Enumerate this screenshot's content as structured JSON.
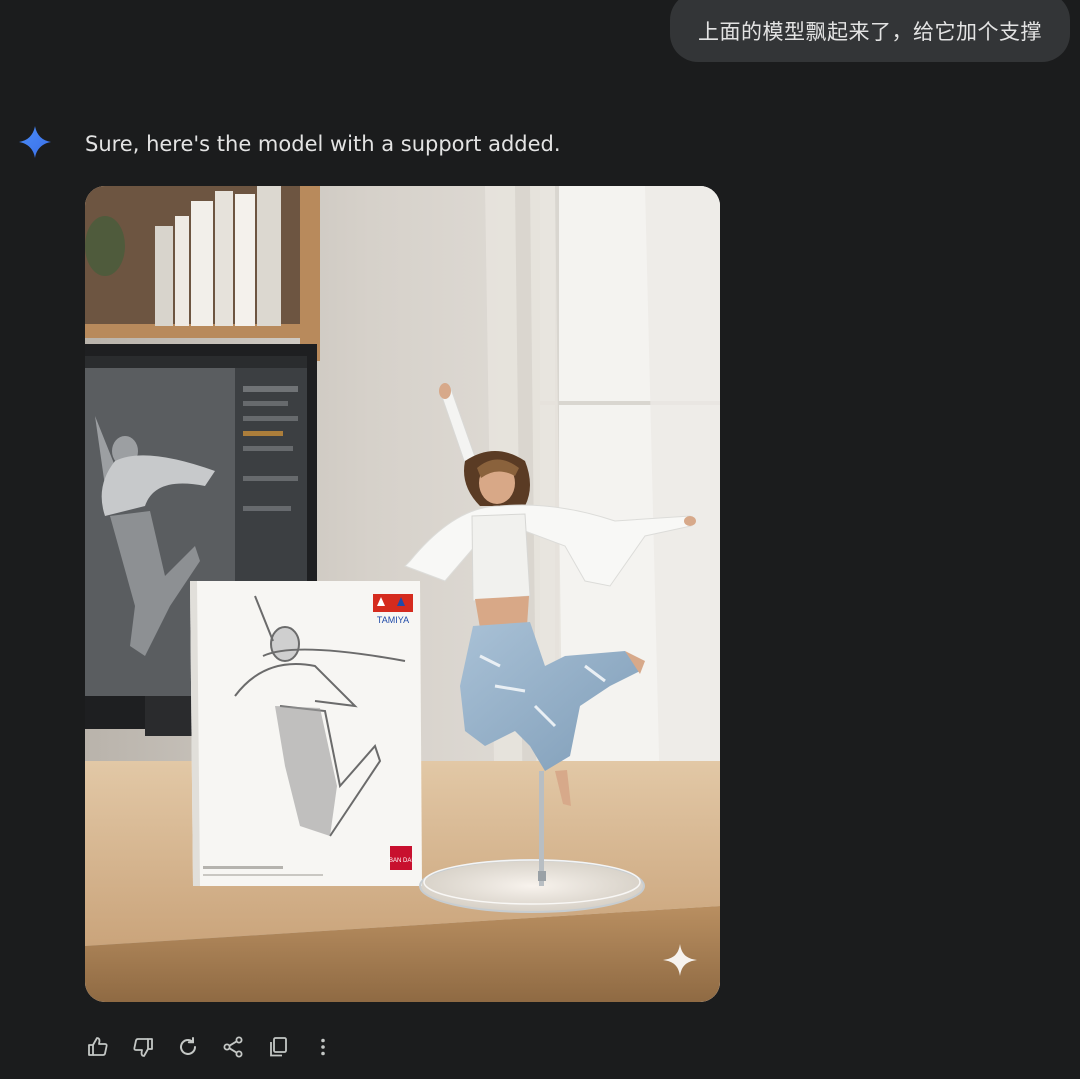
{
  "user_message": {
    "text": "上面的模型飘起来了，给它加个支撑"
  },
  "assistant": {
    "icon": "sparkle-icon",
    "accent_color": "#4b8df8",
    "reply_text": "Sure, here's the model with a support added."
  },
  "generated_image": {
    "alt": "Figure model of a jumping woman in white shirt and ripped jeans on a clear acrylic stand next to a TAMIYA box, on a wooden desk",
    "box_brand_top": "TAMIYA",
    "box_brand_bottom": "BAN DAI",
    "watermark_icon": "sparkle-icon"
  },
  "actions": [
    {
      "name": "thumbs-up-icon",
      "label": "Good response"
    },
    {
      "name": "thumbs-down-icon",
      "label": "Bad response"
    },
    {
      "name": "regenerate-icon",
      "label": "Redo"
    },
    {
      "name": "share-icon",
      "label": "Share"
    },
    {
      "name": "copy-icon",
      "label": "Copy"
    },
    {
      "name": "more-vert-icon",
      "label": "More"
    }
  ]
}
